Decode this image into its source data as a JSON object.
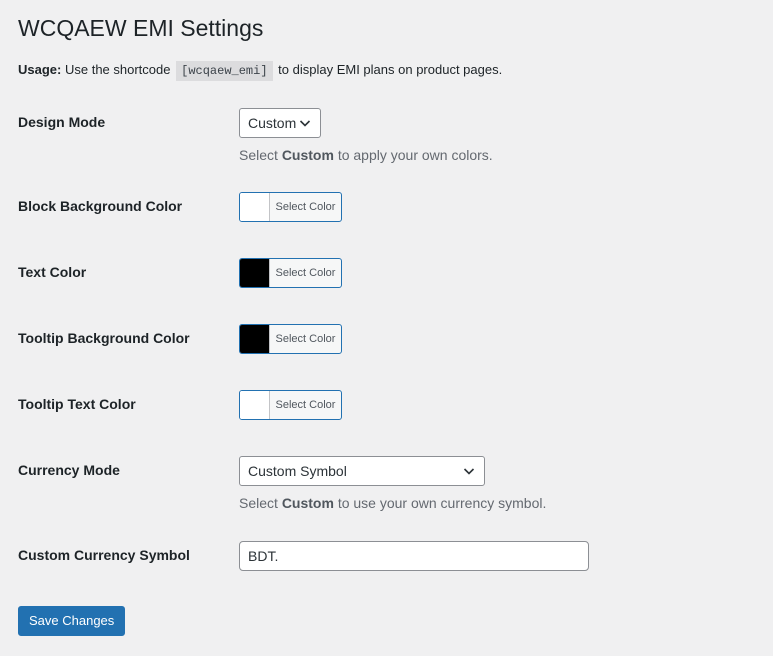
{
  "page": {
    "title": "WCQAEW EMI Settings",
    "usage_label": "Usage:",
    "usage_pre": "Use the shortcode",
    "usage_code": "[wcqaew_emi]",
    "usage_post": "to display EMI plans on product pages."
  },
  "design_mode": {
    "label": "Design Mode",
    "value": "Custom",
    "desc_pre": "Select",
    "desc_bold": "Custom",
    "desc_post": "to apply your own colors."
  },
  "colors": [
    {
      "label": "Block Background Color",
      "button": "Select Color",
      "value": "#ffffff"
    },
    {
      "label": "Text Color",
      "button": "Select Color",
      "value": "#000000"
    },
    {
      "label": "Tooltip Background Color",
      "button": "Select Color",
      "value": "#000000"
    },
    {
      "label": "Tooltip Text Color",
      "button": "Select Color",
      "value": "#ffffff"
    }
  ],
  "currency_mode": {
    "label": "Currency Mode",
    "value": "Custom Symbol",
    "desc_pre": "Select",
    "desc_bold": "Custom",
    "desc_post": "to use your own currency symbol."
  },
  "currency_symbol": {
    "label": "Custom Currency Symbol",
    "value": "BDT."
  },
  "actions": {
    "save_label": "Save Changes"
  },
  "theme": {
    "primary": "#2271b1",
    "background": "#f0f0f1"
  }
}
